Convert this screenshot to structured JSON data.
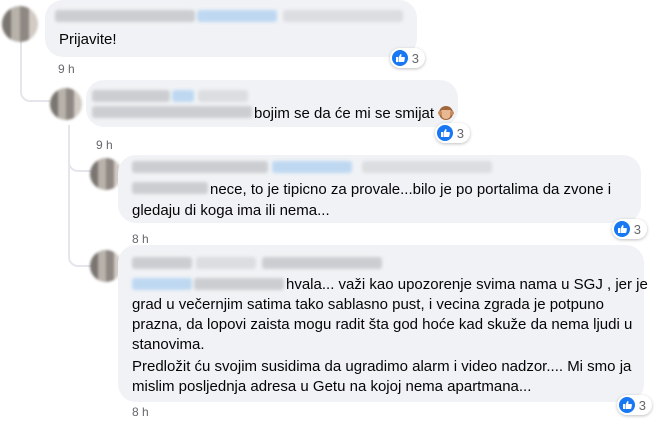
{
  "comments": [
    {
      "text_lines": [
        "Prijavite!"
      ],
      "reaction_count": "3",
      "time": "9 h"
    },
    {
      "text_lines": [
        "bojim se da će mi se smijat"
      ],
      "emoji": "see-no-evil-monkey",
      "reaction_count": "3",
      "time": "9 h"
    },
    {
      "text_lines": [
        "nece, to je tipicno za provale...bilo je po portalima da zvone i",
        "gledaju di koga ima ili nema..."
      ],
      "reaction_count": "3",
      "time": "8 h"
    },
    {
      "text_lines": [
        "hvala... važi kao upozorenje svima nama u SGJ , jer je",
        "grad u večernjim satima tako sablasno pust, i vecina zgrada je potpuno",
        "prazna, da lopovi zaista mogu radit šta god hoće kad skuže da nema ljudi u",
        "stanovima.",
        "Predložit ću svojim susidima da ugradimo alarm i video nadzor.... Mi smo ja",
        "mislim posljednja adresa u Getu na kojoj nema apartmana..."
      ],
      "reaction_count": "3",
      "time": "8 h"
    }
  ],
  "colors": {
    "bubble": "#f0f2f5",
    "like_blue": "#1877f2",
    "time_gray": "#65676b"
  }
}
